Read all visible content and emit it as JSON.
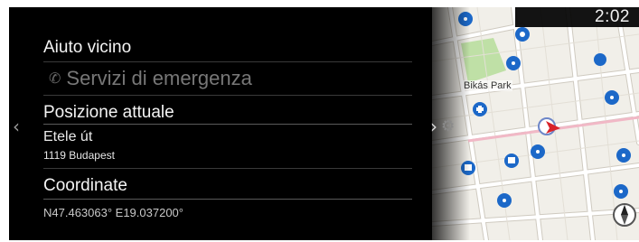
{
  "clock": "2:02",
  "menu": {
    "nearby_help": "Aiuto vicino",
    "emergency_services": "Servizi di emergenza",
    "current_position": "Posizione attuale",
    "street": "Etele út",
    "city": "1119 Budapest",
    "coordinates_label": "Coordinate",
    "coordinates_value": "N47.463063° E19.037200°"
  },
  "map": {
    "park_label": "Bikás Park"
  },
  "icons": {
    "back": "chevron-left-icon",
    "forward": "chevron-right-icon",
    "settings": "gear-icon",
    "compass": "compass-icon",
    "phone": "phone-icon",
    "vehicle": "vehicle-position-icon"
  },
  "colors": {
    "poi_blue": "#1c68c8",
    "vehicle_red": "#d8232a",
    "park_green": "#bfe0a6"
  }
}
